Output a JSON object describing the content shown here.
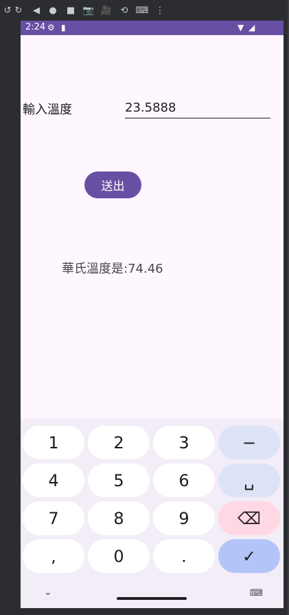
{
  "status_bar": {
    "time": "2:24"
  },
  "form": {
    "input_label": "輸入溫度",
    "input_value": "23.5888",
    "submit_label": "送出",
    "result_text": "華氏溫度是:74.46"
  },
  "keyboard": {
    "keys": [
      "1",
      "2",
      "3",
      "−",
      "4",
      "5",
      "6",
      "␣",
      "7",
      "8",
      "9",
      "⌫",
      ",",
      "0",
      ".",
      "✓"
    ]
  },
  "colors": {
    "primary": "#6750a4",
    "background": "#fef7ff"
  }
}
